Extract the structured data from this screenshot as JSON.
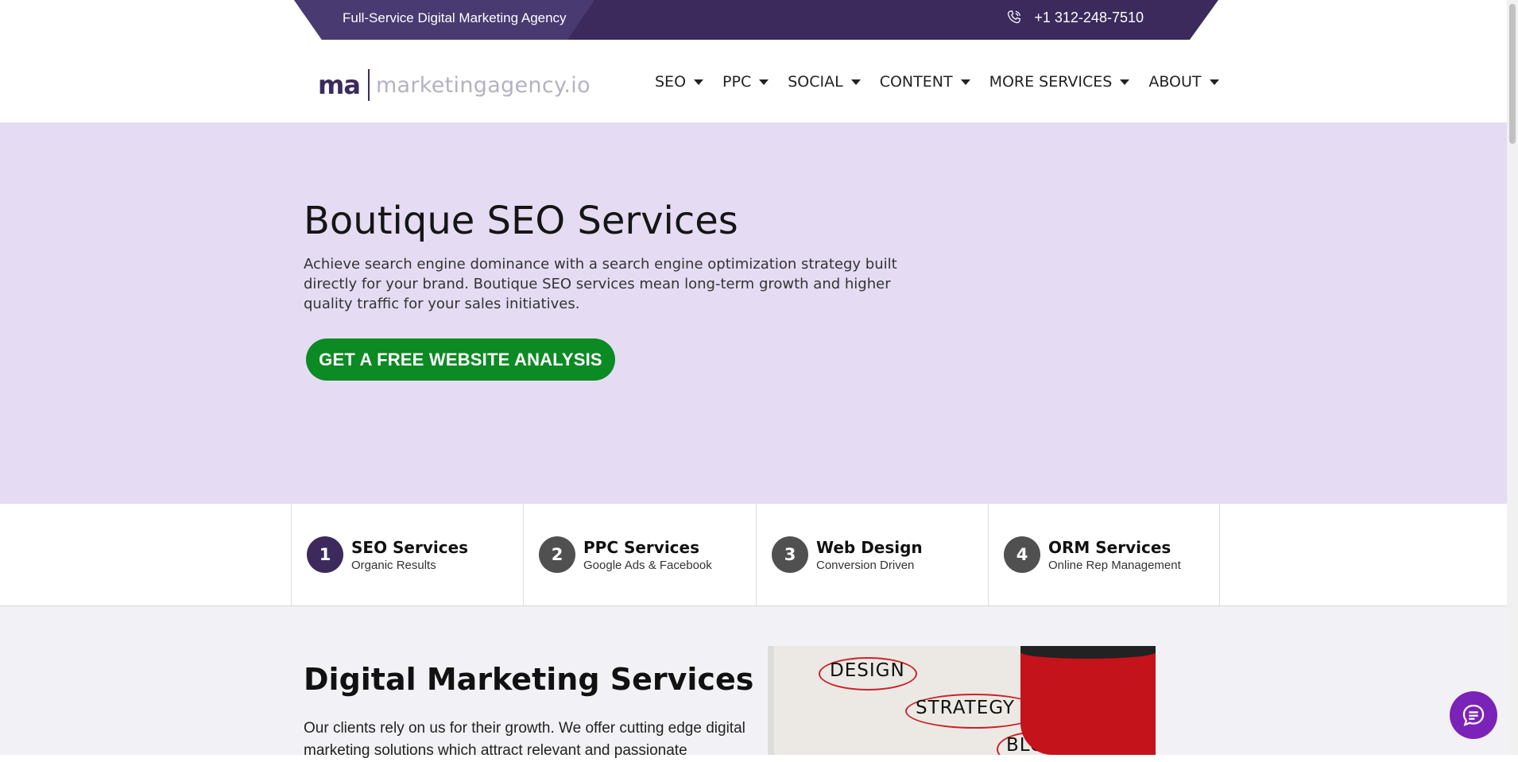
{
  "topbar": {
    "tagline": "Full-Service Digital Marketing Agency",
    "phone": "+1 312-248-7510",
    "phone_icon": "phone-icon"
  },
  "header": {
    "logo_mark": "ma",
    "logo_name": "marketingagency.io",
    "nav": [
      {
        "label": "SEO"
      },
      {
        "label": "PPC"
      },
      {
        "label": "SOCIAL"
      },
      {
        "label": "CONTENT"
      },
      {
        "label": "MORE SERVICES"
      },
      {
        "label": "ABOUT"
      }
    ]
  },
  "hero": {
    "title": "Boutique SEO Services",
    "description": "Achieve search engine dominance with a search engine optimization strategy built directly for your brand. Boutique SEO services mean long-term growth and higher quality traffic for your sales initiatives.",
    "cta": "GET A FREE WEBSITE ANALYSIS"
  },
  "services": [
    {
      "num": "1",
      "title": "SEO Services",
      "subtitle": "Organic Results"
    },
    {
      "num": "2",
      "title": "PPC Services",
      "subtitle": "Google Ads & Facebook"
    },
    {
      "num": "3",
      "title": "Web Design",
      "subtitle": "Conversion Driven"
    },
    {
      "num": "4",
      "title": "ORM Services",
      "subtitle": "Online Rep Management"
    }
  ],
  "content": {
    "title": "Digital Marketing Services",
    "description": "Our clients rely on us for their growth. We offer cutting edge digital marketing solutions which attract relevant and passionate",
    "photo_words": [
      "DESIGN",
      "STRATEGY",
      "BLOG"
    ]
  },
  "colors": {
    "brand_purple": "#3c2a5d",
    "hero_bg": "#e5dcf3",
    "cta_green": "#0c8a24",
    "chat_purple": "#7b22b8"
  }
}
